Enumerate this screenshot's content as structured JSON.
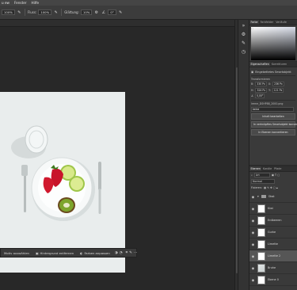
{
  "menubar": {
    "items": [
      "u ew",
      "Fenster",
      "Hilfe"
    ]
  },
  "options": {
    "zoom_value": "100%",
    "flow_label": "Fluss:",
    "flow_value": "100%",
    "smoothing_label": "Glättung:",
    "smoothing_value": "10%",
    "angle_value": "0°"
  },
  "color_panel": {
    "tabs": [
      "Farbe",
      "Farbfelder",
      "Verläufe"
    ]
  },
  "properties": {
    "tabs": [
      "Eigenschaften",
      "Korrekturen"
    ],
    "type_label": "Eingebettetes Smartobjekt",
    "transform_label": "Transformieren",
    "w_label": "B:",
    "w_value": "330 Px",
    "x_label": "X:",
    "x_value": "236 Px",
    "h_label": "H:",
    "h_value": "324 Px",
    "y_label": "Y:",
    "y_value": "121 Px",
    "angle_value": "0,00°",
    "layer_comp": "keine",
    "file_name": "Ireme_DSHP88_2000.png",
    "btn_edit": "Inhalt bearbeiten",
    "btn_convert_linked": "In verknüpftes Smartobjekt konvertieren",
    "btn_convert_layers": "In Ebenen konvertieren"
  },
  "layers": {
    "tabs": [
      "Ebenen",
      "Kanäle",
      "Pfade"
    ],
    "search_placeholder": "Art",
    "blend_mode": "Normal",
    "lock_label": "Fixieren:",
    "items": [
      {
        "name": "Obst",
        "type": "group"
      },
      {
        "name": "Kiwi",
        "type": "layer"
      },
      {
        "name": "Erdbeeren",
        "type": "layer"
      },
      {
        "name": "Gurke",
        "type": "layer"
      },
      {
        "name": "Limette",
        "type": "layer"
      },
      {
        "name": "Limette 2",
        "type": "layer",
        "selected": true
      },
      {
        "name": "Bruhe",
        "type": "photo"
      },
      {
        "name": "Ebene 0",
        "type": "layer"
      }
    ]
  },
  "taskbar": {
    "select_subject": "Motiv auswählen",
    "remove_bg": "Hintergrund entfernen",
    "fill_colors": "Farben anpassen"
  }
}
